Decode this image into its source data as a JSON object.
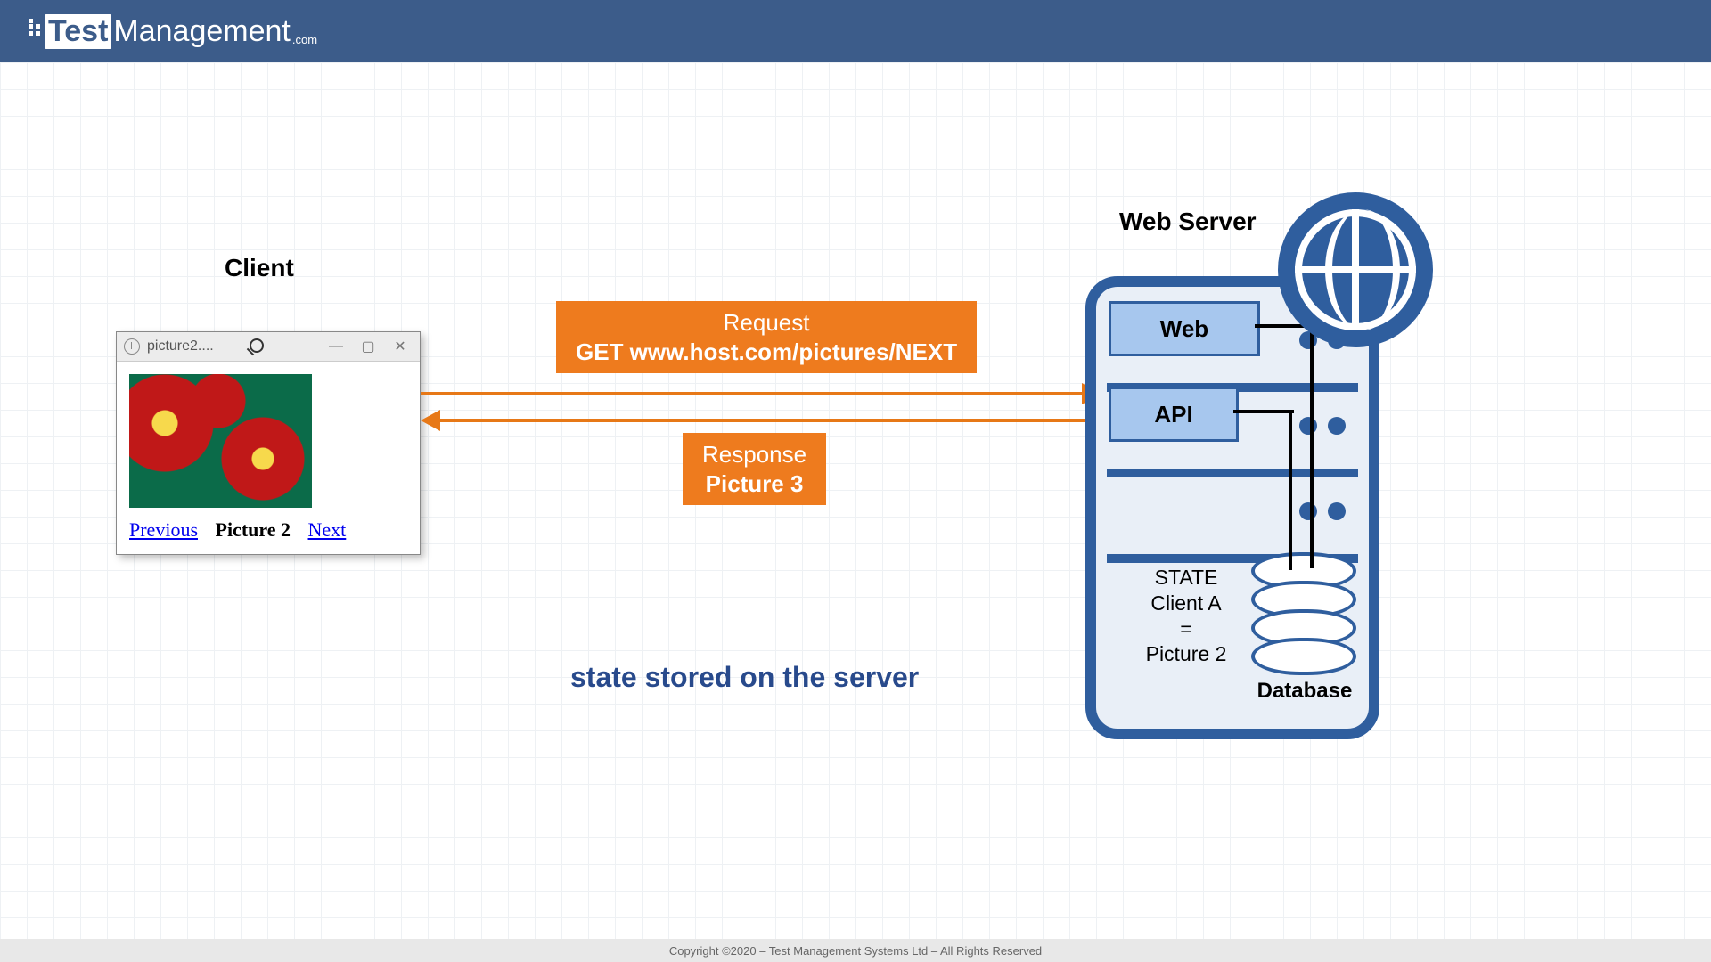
{
  "brand": {
    "test": "Test",
    "mgmt": "Management",
    "dotcom": ".com"
  },
  "labels": {
    "client": "Client",
    "webserver": "Web Server"
  },
  "browser": {
    "tab": "picture2....",
    "prev": "Previous",
    "current": "Picture 2",
    "next": "Next"
  },
  "request": {
    "line1": "Request",
    "line2": "GET www.host.com/pictures/NEXT"
  },
  "response": {
    "line1": "Response",
    "line2": "Picture 3"
  },
  "server": {
    "web": "Web",
    "api": "API",
    "state": {
      "l1": "STATE",
      "l2": "Client A",
      "l3": "=",
      "l4": "Picture 2"
    },
    "database": "Database"
  },
  "caption": "state stored on the server",
  "footer": "Copyright ©2020 – Test Management Systems Ltd – All Rights Reserved"
}
